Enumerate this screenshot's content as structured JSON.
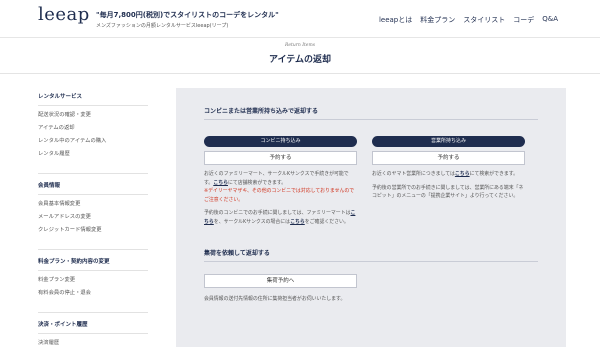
{
  "header": {
    "logo": "leeap",
    "tagline": "\"毎月7,800円(税別)でスタイリストのコーデをレンタル\"",
    "tagline_sub": "メンズファッションの月額レンタルサービスleeap(リープ)",
    "nav": [
      "leeapとは",
      "料金プラン",
      "スタイリスト",
      "コーデ",
      "Q&A"
    ]
  },
  "page": {
    "title_en": "Return Items",
    "title": "アイテムの返却"
  },
  "sidebar": {
    "groups": [
      {
        "heading": "レンタルサービス",
        "items": [
          "配送状況の確認・変更",
          "アイテムの返却",
          "レンタル中のアイテムの購入",
          "レンタル履歴"
        ]
      },
      {
        "heading": "会員情報",
        "items": [
          "会員基本情報変更",
          "メールアドレスの変更",
          "クレジットカード情報変更"
        ]
      },
      {
        "heading": "料金プラン・契約内容の変更",
        "items": [
          "料金プラン変更",
          "有料会員の停止・退会"
        ]
      },
      {
        "heading": "決済・ポイント履歴",
        "items": [
          "決済履歴"
        ]
      }
    ]
  },
  "main": {
    "section1": {
      "title": "コンビニまたは営業所持ち込みで返却する",
      "left": {
        "pill": "コンビニ持ち込み",
        "button": "予約する",
        "p1_a": "お近くのファミリーマート、サークルKサンクスで手続きが可能です。",
        "p1_link": "こちら",
        "p1_b": "にて店舗検索ができます。",
        "p1_red": "※デイリーヤマザキ、その他のコンビニでは対応しておりませんのでご注意ください。",
        "p2_a": "予約後のコンビニでのお手続に関しましては、ファミリーマートは",
        "p2_link1": "こちら",
        "p2_b": "を、サークルKサンクスの場合には",
        "p2_link2": "こちら",
        "p2_c": "をご確認ください。"
      },
      "right": {
        "pill": "営業所持ち込み",
        "button": "予約する",
        "p1_a": "お近くのヤマト営業所につきましては",
        "p1_link": "こちら",
        "p1_b": "にて検索ができます。",
        "p2": "予約後の営業所でのお手続きに関しましては、営業所にある端末「ネコピット」のメニューの「提携企業サイト」より行ってください。"
      }
    },
    "section2": {
      "title": "集荷を依頼して返却する",
      "button": "集荷予約へ",
      "text": "会員情報の送付先情報の住所に集荷担当者がお伺いいたします。"
    }
  }
}
